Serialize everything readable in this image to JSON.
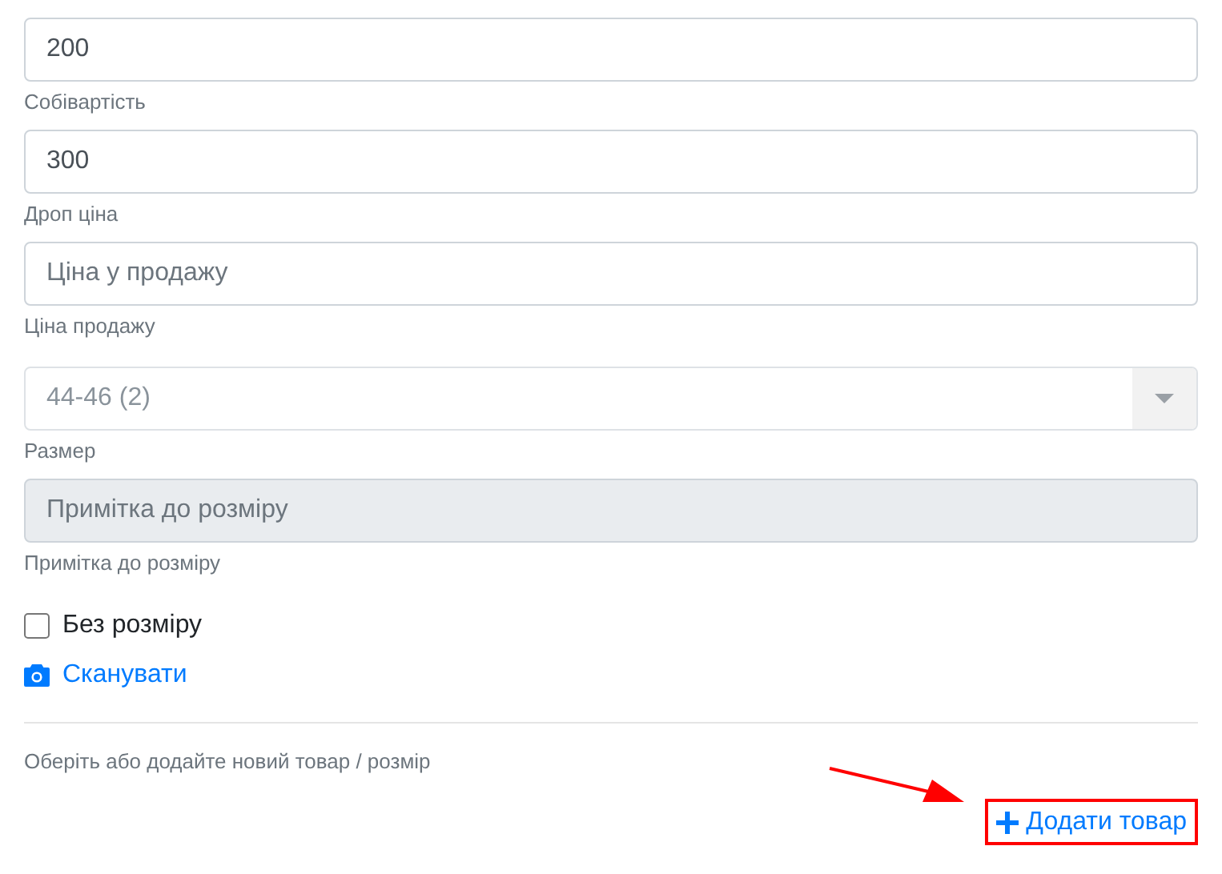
{
  "fields": [
    {
      "kind": "input",
      "value": "200",
      "label": "Собівартість"
    },
    {
      "kind": "input",
      "value": "300",
      "label": "Дроп ціна"
    },
    {
      "kind": "input",
      "placeholder": "Ціна у продажу",
      "label": "Ціна продажу"
    },
    {
      "kind": "select",
      "value": "44-46 (2)",
      "label": "Размер"
    },
    {
      "kind": "input",
      "placeholder": "Примітка до розміру",
      "disabled": true,
      "label": "Примітка до розміру"
    }
  ],
  "no_size": {
    "label": "Без розміру",
    "checked": false
  },
  "scan_link": "Сканувати",
  "hint": "Оберіть або додайте новий товар / розмір",
  "add_button": {
    "label": "Додати товар",
    "highlighted": true
  }
}
